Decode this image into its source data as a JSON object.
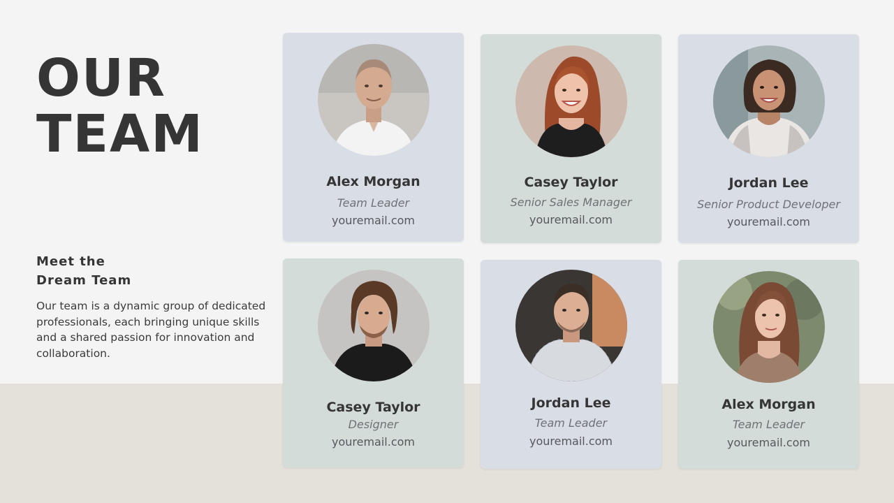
{
  "heading": {
    "line1": "OUR",
    "line2": "TEAM"
  },
  "subheading": {
    "line1": "Meet the",
    "line2": "Dream Team"
  },
  "intro": "Our team is a dynamic group of dedicated professionals, each bringing unique skills and a shared passion for innovation and collaboration.",
  "members": [
    {
      "name": "Alex Morgan",
      "role": "Team Leader",
      "email": "youremail.com",
      "photo": "bald-man-white-shirt-portrait"
    },
    {
      "name": "Casey Taylor",
      "role": "Senior Sales Manager",
      "email": "youremail.com",
      "photo": "red-haired-woman-smiling-portrait"
    },
    {
      "name": "Jordan Lee",
      "role": "Senior Product Developer",
      "email": "youremail.com",
      "photo": "curly-haired-woman-portrait"
    },
    {
      "name": "Casey Taylor",
      "role": "Designer",
      "email": "youremail.com",
      "photo": "young-man-black-tshirt-portrait"
    },
    {
      "name": "Jordan Lee",
      "role": "Team Leader",
      "email": "youremail.com",
      "photo": "man-plaid-shirt-portrait"
    },
    {
      "name": "Alex Morgan",
      "role": "Team Leader",
      "email": "youremail.com",
      "photo": "long-haired-woman-portrait"
    }
  ],
  "colors": {
    "background": "#f4f4f4",
    "floor": "#e4e0da",
    "card_blue": "#d9dde6",
    "card_green": "#d3dcd9",
    "text_dark": "#353535"
  }
}
